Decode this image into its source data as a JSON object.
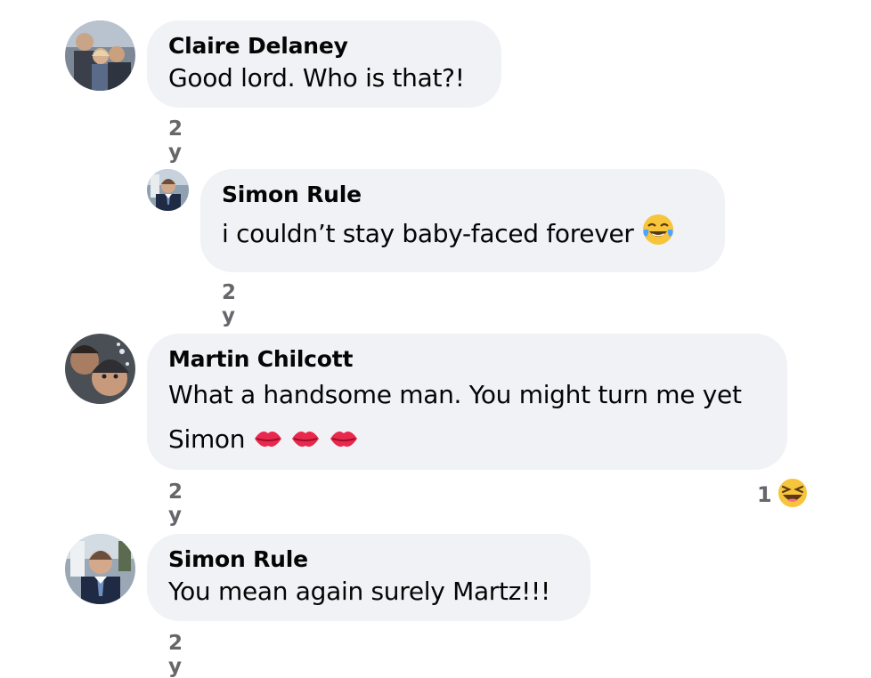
{
  "comments": [
    {
      "author": "Claire Delaney",
      "text": "Good lord. Who is that?!",
      "time": "2 y"
    },
    {
      "author": "Simon Rule",
      "text": "i couldn’t stay baby-faced forever",
      "text_emoji": "face-with-tears-of-joy-icon",
      "time": "2 y"
    },
    {
      "author": "Martin Chilcott",
      "text_line1": "What a handsome man. You might turn me yet",
      "text_line2": "Simon",
      "text_emoji": "kiss-mark-icon",
      "time": "2 y",
      "reaction": {
        "count": "1",
        "icon": "laughing-face-icon"
      }
    },
    {
      "author": "Simon Rule",
      "text": "You mean again surely Martz!!!",
      "time": "2 y"
    }
  ],
  "colors": {
    "bubble_bg": "#f0f2f5",
    "timestamp": "#65676b",
    "reaction_yellow": "#f7c53b"
  }
}
